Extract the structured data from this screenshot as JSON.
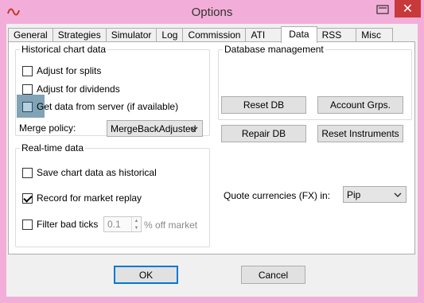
{
  "window": {
    "title": "Options",
    "close_glyph": "✕",
    "accent": "#f2aed8",
    "close_color": "#c7393a"
  },
  "tabs": [
    {
      "label": "General"
    },
    {
      "label": "Strategies"
    },
    {
      "label": "Simulator"
    },
    {
      "label": "Log"
    },
    {
      "label": "Commission"
    },
    {
      "label": "ATI"
    },
    {
      "label": "Data",
      "active": true
    },
    {
      "label": "RSS"
    },
    {
      "label": "Misc"
    }
  ],
  "historical": {
    "legend": "Historical chart data",
    "adjust_splits": {
      "label": "Adjust for splits",
      "checked": false
    },
    "adjust_dividends": {
      "label": "Adjust for dividends",
      "checked": false
    },
    "get_from_server": {
      "label": "Get data from server (if available)",
      "checked": false
    },
    "merge_policy_label": "Merge policy:",
    "merge_policy_value": "MergeBackAdjusted"
  },
  "database": {
    "legend": "Database management",
    "reset_db": "Reset DB",
    "account_grps": "Account Grps.",
    "repair_db": "Repair DB",
    "reset_instruments": "Reset Instruments"
  },
  "realtime": {
    "legend": "Real-time data",
    "save_chart": {
      "label": "Save chart data as historical",
      "checked": false
    },
    "record_replay": {
      "label": "Record for market replay",
      "checked": true
    },
    "filter_bad_ticks": {
      "label": "Filter bad ticks",
      "checked": false
    },
    "filter_value": "0.1",
    "filter_suffix": "% off market"
  },
  "quote_currencies": {
    "label": "Quote currencies (FX) in:",
    "value": "Pip"
  },
  "footer": {
    "ok": "OK",
    "cancel": "Cancel"
  }
}
